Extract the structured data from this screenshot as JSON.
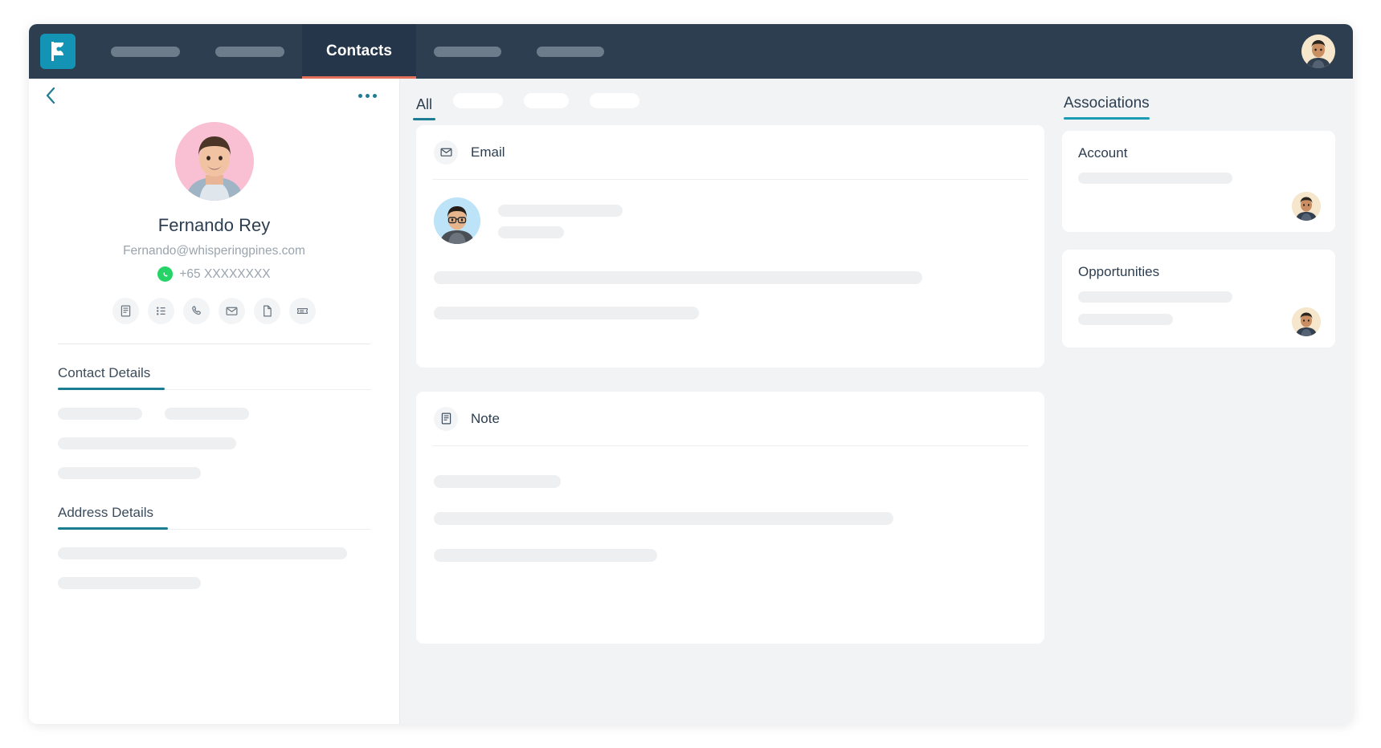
{
  "app": {
    "logo_icon": "p-flag-logo-icon",
    "accent_teal": "#1b7c92",
    "accent_orange": "#e5705a",
    "topbar_color": "#2d3e50"
  },
  "topnav": {
    "items": [
      {
        "label": "",
        "placeholder": true
      },
      {
        "label": "",
        "placeholder": true
      },
      {
        "label": "Contacts",
        "placeholder": false,
        "active": true
      },
      {
        "label": "",
        "placeholder": true
      },
      {
        "label": "",
        "placeholder": true
      }
    ],
    "user_avatar": "user-avatar"
  },
  "sidebar": {
    "back_icon": "chevron-left-icon",
    "more_icon": "more-options-icon",
    "profile": {
      "avatar": "contact-avatar",
      "name": "Fernando Rey",
      "email": "Fernando@whisperingpines.com",
      "phone": "+65 XXXXXXXX",
      "phone_channel_icon": "whatsapp-icon"
    },
    "actions": [
      {
        "icon": "note-icon"
      },
      {
        "icon": "task-list-icon"
      },
      {
        "icon": "phone-icon"
      },
      {
        "icon": "email-icon"
      },
      {
        "icon": "document-icon"
      },
      {
        "icon": "ticket-icon"
      }
    ],
    "sections": [
      {
        "title": "Contact Details"
      },
      {
        "title": "Address Details"
      }
    ]
  },
  "main": {
    "tabs": [
      {
        "label": "All",
        "active": true
      },
      {
        "label": "",
        "placeholder": true
      },
      {
        "label": "",
        "placeholder": true
      },
      {
        "label": "",
        "placeholder": true
      }
    ],
    "cards": [
      {
        "title": "Email",
        "icon": "email-icon",
        "avatar": "sender-avatar"
      },
      {
        "title": "Note",
        "icon": "note-icon"
      }
    ]
  },
  "associations": {
    "title": "Associations",
    "cards": [
      {
        "title": "Account",
        "avatar": "account-owner-avatar"
      },
      {
        "title": "Opportunities",
        "avatar": "opportunity-owner-avatar"
      }
    ]
  }
}
